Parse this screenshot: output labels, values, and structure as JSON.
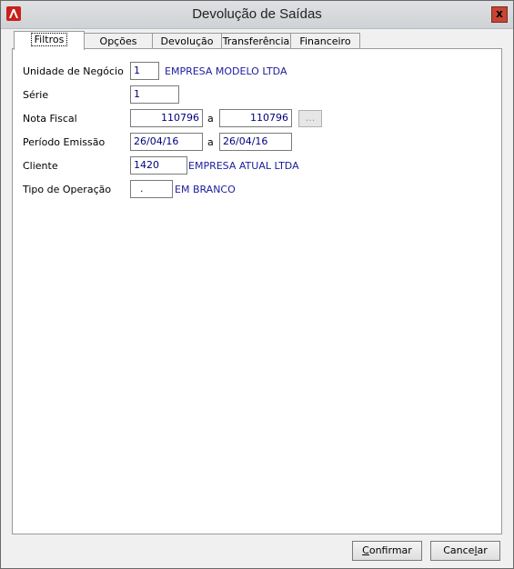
{
  "window": {
    "title": "Devolução de Saídas",
    "close_label": "x"
  },
  "tabs": [
    {
      "label": "Filtros"
    },
    {
      "label": "Opções"
    },
    {
      "label": "Devolução"
    },
    {
      "label": "Transferência"
    },
    {
      "label": "Financeiro"
    }
  ],
  "form": {
    "unidade": {
      "label": "Unidade de Negócio",
      "value": "1",
      "desc": "EMPRESA MODELO LTDA"
    },
    "serie": {
      "label": "Série",
      "value": "1"
    },
    "nota": {
      "label": "Nota Fiscal",
      "from": "110796",
      "sep": "a",
      "to": "110796",
      "lookup_label": "..."
    },
    "periodo": {
      "label": "Período Emissão",
      "from": "26/04/16",
      "sep": "a",
      "to": "26/04/16"
    },
    "cliente": {
      "label": "Cliente",
      "value": "1420",
      "desc": "EMPRESA ATUAL LTDA"
    },
    "tipo": {
      "label": "Tipo de Operação",
      "value": ".",
      "desc": "EM BRANCO"
    }
  },
  "buttons": {
    "confirm_hotkey": "C",
    "confirm_rest": "onfirmar",
    "cancel_hotkey": "l",
    "cancel_pre": "Cance",
    "cancel_rest": "ar"
  },
  "icons": {
    "app": "app-logo-icon",
    "close": "close-icon"
  },
  "colors": {
    "value_text": "#000080",
    "desc_text": "#1c1c9c",
    "close_bg": "#c74533"
  }
}
